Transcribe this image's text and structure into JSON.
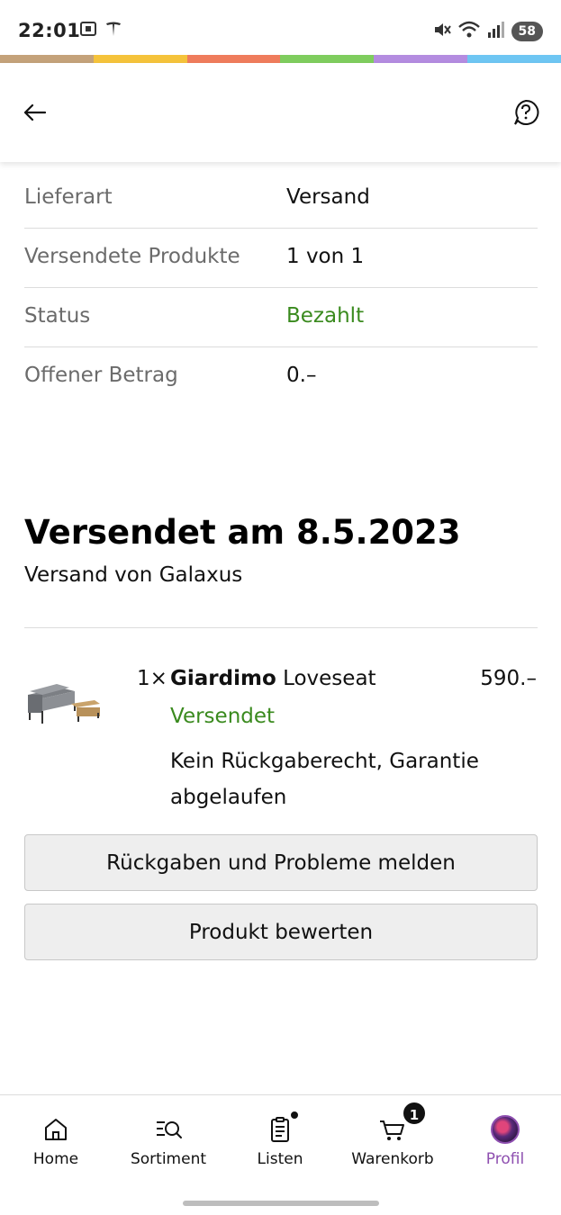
{
  "status_bar": {
    "time": "22:01",
    "battery": "58",
    "icons": [
      "screenshot-icon",
      "tesla-icon",
      "mute-icon",
      "wifi-icon",
      "signal-icon"
    ]
  },
  "brand_stripe_colors": [
    "#c4a27a",
    "#f5c33b",
    "#ef7c5c",
    "#7fcd5e",
    "#b48ce0",
    "#6ec6f3"
  ],
  "details": [
    {
      "label": "Lieferart",
      "value": "Versand",
      "value_color": "#111111"
    },
    {
      "label": "Versendete Produkte",
      "value": "1 von 1",
      "value_color": "#111111"
    },
    {
      "label": "Status",
      "value": "Bezahlt",
      "value_color": "#3a8a1e"
    },
    {
      "label": "Offener Betrag",
      "value": "0.–",
      "value_color": "#111111"
    }
  ],
  "shipment": {
    "title": "Versendet am 8.5.2023",
    "subtitle": "Versand von Galaxus"
  },
  "product": {
    "quantity": "1×",
    "brand": "Giardimo",
    "name": "Loveseat",
    "price": "590.–",
    "status": "Versendet",
    "note": "Kein Rückgaberecht, Garantie abgelaufen"
  },
  "actions": {
    "report_label": "Rückgaben und Probleme melden",
    "rate_label": "Produkt bewerten"
  },
  "nav": {
    "home": "Home",
    "sortiment": "Sortiment",
    "listen": "Listen",
    "warenkorb": "Warenkorb",
    "warenkorb_count": "1",
    "profil": "Profil",
    "active_color": "#8e4fb0"
  }
}
